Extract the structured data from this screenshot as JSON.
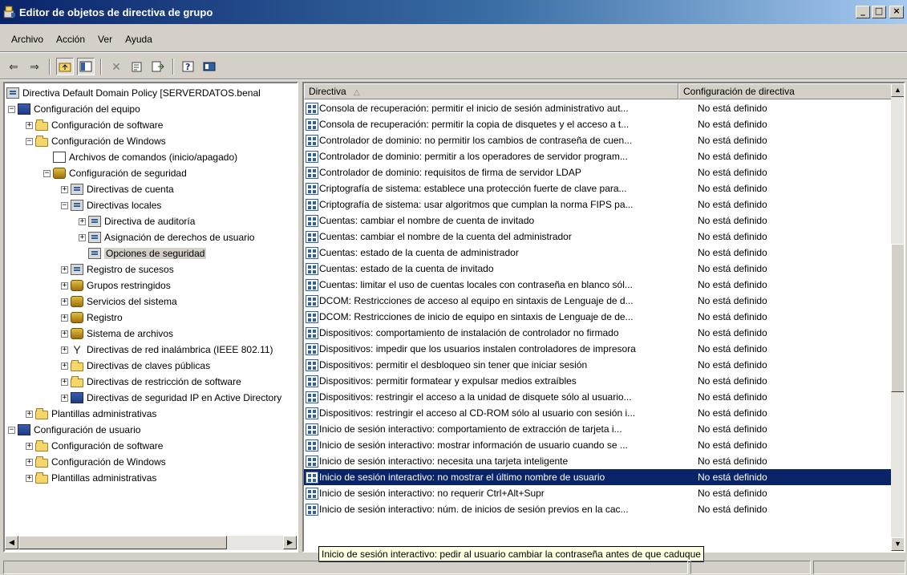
{
  "window": {
    "title": "Editor de objetos de directiva de grupo"
  },
  "menu": [
    "Archivo",
    "Acción",
    "Ver",
    "Ayuda"
  ],
  "toolbar": [
    "back-icon",
    "forward-icon",
    "up-folder-icon",
    "show-tree-icon",
    "delete-icon",
    "properties-icon",
    "export-icon",
    "help-icon",
    "console-icon"
  ],
  "tree": [
    {
      "label": "Directiva Default Domain Policy [SERVERDATOS.benal",
      "icon": "policy"
    },
    {
      "label": "Configuración del equipo",
      "icon": "computer"
    },
    {
      "label": "Configuración de software",
      "icon": "folder"
    },
    {
      "label": "Configuración de Windows",
      "icon": "folder"
    },
    {
      "label": "Archivos de comandos (inicio/apagado)",
      "icon": "script"
    },
    {
      "label": "Configuración de seguridad",
      "icon": "shield"
    },
    {
      "label": "Directivas de cuenta",
      "icon": "policy"
    },
    {
      "label": "Directivas locales",
      "icon": "policy"
    },
    {
      "label": "Directiva de auditoría",
      "icon": "policy"
    },
    {
      "label": "Asignación de derechos de usuario",
      "icon": "policy"
    },
    {
      "label": "Opciones de seguridad",
      "icon": "policy"
    },
    {
      "label": "Registro de sucesos",
      "icon": "policy"
    },
    {
      "label": "Grupos restringidos",
      "icon": "shield"
    },
    {
      "label": "Servicios del sistema",
      "icon": "shield"
    },
    {
      "label": "Registro",
      "icon": "shield"
    },
    {
      "label": "Sistema de archivos",
      "icon": "shield"
    },
    {
      "label": "Directivas de red inalámbrica (IEEE 802.11)",
      "icon": "antenna"
    },
    {
      "label": "Directivas de claves públicas",
      "icon": "folder"
    },
    {
      "label": "Directivas de restricción de software",
      "icon": "folder"
    },
    {
      "label": "Directivas de seguridad IP en Active Directory",
      "icon": "computer"
    },
    {
      "label": "Plantillas administrativas",
      "icon": "folder"
    },
    {
      "label": "Configuración de usuario",
      "icon": "computer"
    },
    {
      "label": "Configuración de software",
      "icon": "folder"
    },
    {
      "label": "Configuración de Windows",
      "icon": "folder"
    },
    {
      "label": "Plantillas administrativas",
      "icon": "folder"
    }
  ],
  "list": {
    "columns": [
      "Directiva",
      "Configuración de directiva"
    ],
    "rows": [
      {
        "name": "Consola de recuperación: permitir el inicio de sesión administrativo aut...",
        "value": "No está definido"
      },
      {
        "name": "Consola de recuperación: permitir la copia de disquetes y el acceso a t...",
        "value": "No está definido"
      },
      {
        "name": "Controlador de dominio: no permitir los cambios de contraseña de cuen...",
        "value": "No está definido"
      },
      {
        "name": "Controlador de dominio: permitir a los operadores de servidor program...",
        "value": "No está definido"
      },
      {
        "name": "Controlador de dominio: requisitos de firma de servidor LDAP",
        "value": "No está definido"
      },
      {
        "name": "Criptografía de sistema: establece una protección fuerte de clave para...",
        "value": "No está definido"
      },
      {
        "name": "Criptografía de sistema: usar algoritmos que cumplan la norma FIPS pa...",
        "value": "No está definido"
      },
      {
        "name": "Cuentas: cambiar el nombre de cuenta de invitado",
        "value": "No está definido"
      },
      {
        "name": "Cuentas: cambiar el nombre de la cuenta del administrador",
        "value": "No está definido"
      },
      {
        "name": "Cuentas: estado de la cuenta de administrador",
        "value": "No está definido"
      },
      {
        "name": "Cuentas: estado de la cuenta de invitado",
        "value": "No está definido"
      },
      {
        "name": "Cuentas: limitar el uso de cuentas locales con contraseña en blanco sól...",
        "value": "No está definido"
      },
      {
        "name": "DCOM: Restricciones de acceso al equipo en sintaxis de Lenguaje de d...",
        "value": "No está definido"
      },
      {
        "name": "DCOM: Restricciones de inicio de equipo en sintaxis de Lenguaje de de...",
        "value": "No está definido"
      },
      {
        "name": "Dispositivos: comportamiento de instalación de controlador no firmado",
        "value": "No está definido"
      },
      {
        "name": "Dispositivos: impedir que los usuarios instalen controladores de impresora",
        "value": "No está definido"
      },
      {
        "name": "Dispositivos: permitir el desbloqueo sin tener que iniciar sesión",
        "value": "No está definido"
      },
      {
        "name": "Dispositivos: permitir formatear y expulsar medios extraíbles",
        "value": "No está definido"
      },
      {
        "name": "Dispositivos: restringir el acceso a la unidad de disquete sólo al usuario...",
        "value": "No está definido"
      },
      {
        "name": "Dispositivos: restringir el acceso al CD-ROM sólo al usuario con sesión i...",
        "value": "No está definido"
      },
      {
        "name": "Inicio de sesión interactivo: comportamiento de extracción de tarjeta i...",
        "value": "No está definido"
      },
      {
        "name": "Inicio de sesión interactivo: mostrar información de usuario cuando se ...",
        "value": "No está definido"
      },
      {
        "name": "Inicio de sesión interactivo: necesita una tarjeta inteligente",
        "value": "No está definido"
      },
      {
        "name": "Inicio de sesión interactivo: no mostrar el último nombre de usuario",
        "value": "No está definido"
      },
      {
        "name": "Inicio de sesión interactivo: no requerir Ctrl+Alt+Supr",
        "value": "No está definido"
      },
      {
        "name": "Inicio de sesión interactivo: núm. de inicios de sesión previos en la cac...",
        "value": "No está definido"
      }
    ],
    "selected_index": 23
  },
  "tooltip": "Inicio de sesión interactivo: pedir al usuario cambiar la contraseña antes de que caduque",
  "colors": {
    "title_start": "#0a246a",
    "title_end": "#a6caf0",
    "selection": "#0a246a",
    "face": "#d4d0c8",
    "tooltip_bg": "#ffffe1"
  }
}
